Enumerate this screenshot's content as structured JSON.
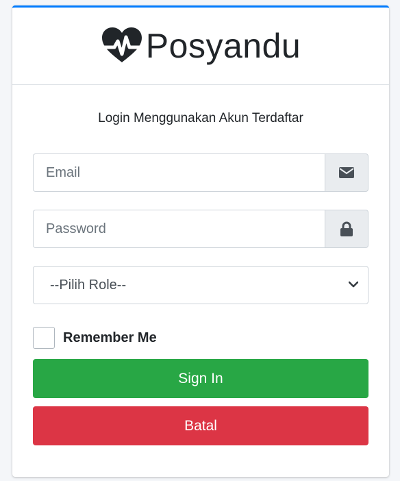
{
  "brand": {
    "name": "Posyandu",
    "icon": "heartbeat-icon",
    "color": "#212529"
  },
  "login": {
    "message": "Login Menggunakan Akun Terdaftar",
    "email_placeholder": "Email",
    "email_icon": "envelope-icon",
    "password_placeholder": "Password",
    "password_icon": "lock-icon",
    "role_select_value": "--Pilih Role--",
    "remember_label": "Remember Me",
    "remember_checked": false,
    "signin_label": "Sign In",
    "cancel_label": "Batal"
  },
  "colors": {
    "accent": "#007bff",
    "signin": "#28a745",
    "cancel": "#dc3545",
    "addon_bg": "#e9ecef"
  }
}
